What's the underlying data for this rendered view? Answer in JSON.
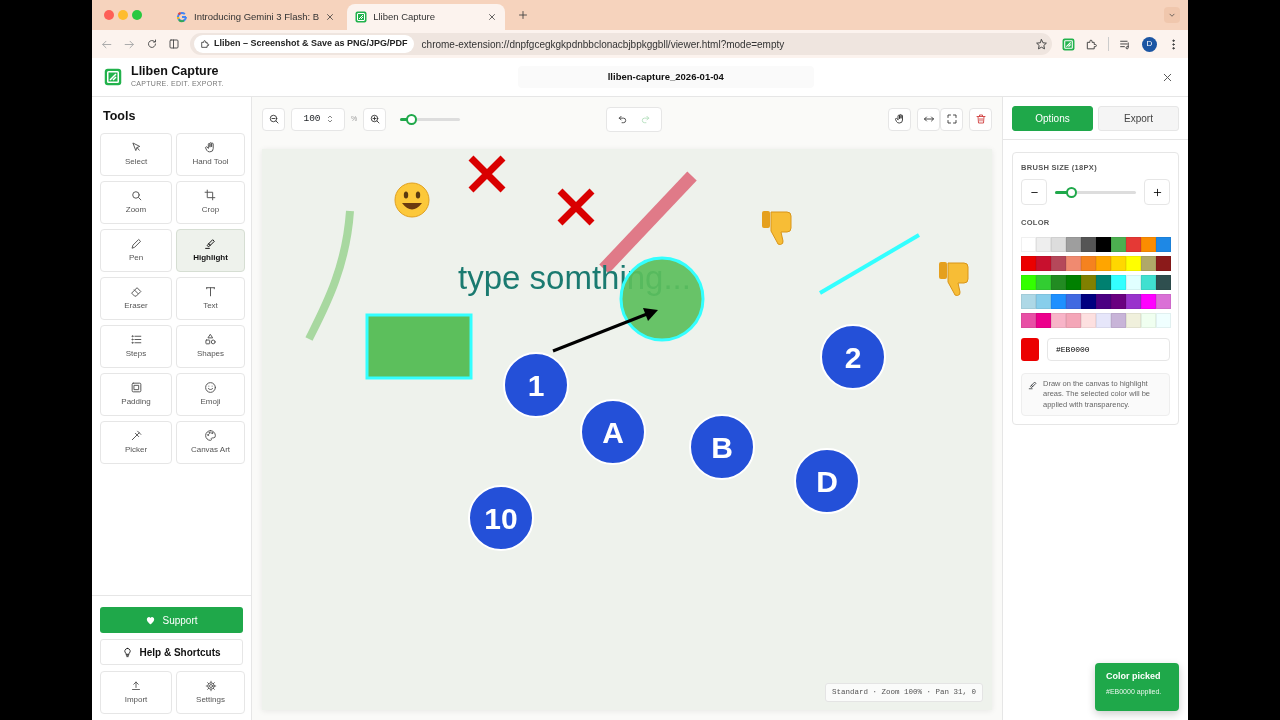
{
  "browser": {
    "tabs": [
      {
        "title": "Introducing Gemini 3 Flash: B",
        "selected": false
      },
      {
        "title": "Lliben Capture",
        "selected": true
      }
    ],
    "site_chip": "Lliben – Screenshot & Save as PNG/JPG/PDF",
    "url": "chrome-extension://dnpfgcegkgkpdnbbclonacbjbpkggbll/viewer.html?mode=empty",
    "profile_initial": "D"
  },
  "app": {
    "title": "Lliben Capture",
    "tagline": "CAPTURE. EDIT. EXPORT.",
    "file_name": "lliben-capture_2026-01-04"
  },
  "sidebar": {
    "title": "Tools",
    "tools": [
      {
        "label": "Select",
        "selected": false
      },
      {
        "label": "Hand Tool",
        "selected": false
      },
      {
        "label": "Zoom",
        "selected": false
      },
      {
        "label": "Crop",
        "selected": false
      },
      {
        "label": "Pen",
        "selected": false
      },
      {
        "label": "Highlight",
        "selected": true
      },
      {
        "label": "Eraser",
        "selected": false
      },
      {
        "label": "Text",
        "selected": false
      },
      {
        "label": "Steps",
        "selected": false
      },
      {
        "label": "Shapes",
        "selected": false
      },
      {
        "label": "Padding",
        "selected": false
      },
      {
        "label": "Emoji",
        "selected": false
      },
      {
        "label": "Picker",
        "selected": false
      },
      {
        "label": "Canvas Art",
        "selected": false
      }
    ],
    "support": "Support",
    "help": "Help & Shortcuts",
    "footer_buttons": [
      {
        "label": "Import"
      },
      {
        "label": "Settings"
      }
    ]
  },
  "toolbar": {
    "zoom_value": "100",
    "zoom_unit": "%",
    "zoom_slider": {
      "level": 0.18
    },
    "undo": {
      "disabled": false
    },
    "redo": {
      "disabled": true
    }
  },
  "canvas": {
    "annotations": [
      {
        "kind": "stroke",
        "color": "#a8d8a0"
      },
      {
        "kind": "smiley"
      },
      {
        "kind": "cross",
        "color": "#d90000"
      },
      {
        "kind": "cross",
        "color": "#d90000"
      },
      {
        "kind": "stroke",
        "color": "#e07a88"
      },
      {
        "kind": "thumbs-down"
      },
      {
        "kind": "line",
        "color": "#33ffff"
      },
      {
        "kind": "thumbs-down"
      },
      {
        "kind": "text",
        "text": "type somthing...",
        "color": "#1a7a70"
      },
      {
        "kind": "rect",
        "color": "#5cbf5c"
      },
      {
        "kind": "circle",
        "color": "#5cbf5c"
      },
      {
        "kind": "arrow",
        "color": "#000000"
      },
      {
        "kind": "step",
        "text": "2"
      },
      {
        "kind": "step",
        "text": "1"
      },
      {
        "kind": "step",
        "text": "A"
      },
      {
        "kind": "step",
        "text": "B"
      },
      {
        "kind": "step",
        "text": "D"
      },
      {
        "kind": "step",
        "text": "10"
      }
    ],
    "status": "Standard · Zoom 100% · Pan 31, 0"
  },
  "panel": {
    "tabs": [
      {
        "label": "Options",
        "selected": true
      },
      {
        "label": "Export",
        "selected": false
      }
    ],
    "brush_label": "BRUSH SIZE (18PX)",
    "brush_slider": {
      "level": 0.2
    },
    "color_label": "COLOR",
    "palette": [
      {
        "color": "#ffffff"
      },
      {
        "color": "#eeeeee"
      },
      {
        "color": "#dddddd"
      },
      {
        "color": "#9e9e9e"
      },
      {
        "color": "#555555"
      },
      {
        "color": "#000000"
      },
      {
        "color": "#4caf50"
      },
      {
        "color": "#e53935"
      },
      {
        "color": "#fb8c00"
      },
      {
        "color": "#1e88e5"
      },
      {
        "color": "#eb0000"
      },
      {
        "color": "#c8102e"
      },
      {
        "color": "#b5485a"
      },
      {
        "color": "#f08a70"
      },
      {
        "color": "#f5821f"
      },
      {
        "color": "#ffa500"
      },
      {
        "color": "#ffd700"
      },
      {
        "color": "#ffff00"
      },
      {
        "color": "#b0a868"
      },
      {
        "color": "#8b1a1a"
      },
      {
        "color": "#33ff00"
      },
      {
        "color": "#32cd32"
      },
      {
        "color": "#228b22"
      },
      {
        "color": "#008000"
      },
      {
        "color": "#808000"
      },
      {
        "color": "#008070"
      },
      {
        "color": "#33ffff"
      },
      {
        "color": "#e0ffff"
      },
      {
        "color": "#40e0d0"
      },
      {
        "color": "#2f4f4f"
      },
      {
        "color": "#add8e6"
      },
      {
        "color": "#87ceeb"
      },
      {
        "color": "#1e90ff"
      },
      {
        "color": "#4169e1"
      },
      {
        "color": "#000080"
      },
      {
        "color": "#4b0082"
      },
      {
        "color": "#6a0080"
      },
      {
        "color": "#9932cc"
      },
      {
        "color": "#ff00ff"
      },
      {
        "color": "#da70d6"
      },
      {
        "color": "#e84fa5"
      },
      {
        "color": "#ec008c"
      },
      {
        "color": "#f8b4c8"
      },
      {
        "color": "#f4a6b8"
      },
      {
        "color": "#fde0e0"
      },
      {
        "color": "#e6e6fa"
      },
      {
        "color": "#c8b4d8"
      },
      {
        "color": "#f0f0dc"
      },
      {
        "color": "#f0fff0"
      },
      {
        "color": "#f0ffff"
      }
    ],
    "hex_value": "#EB0000",
    "hint": "Draw on the canvas to highlight areas. The selected color will be applied with transparency."
  },
  "toast": {
    "title": "Color picked",
    "message": "#EB0000 applied."
  }
}
